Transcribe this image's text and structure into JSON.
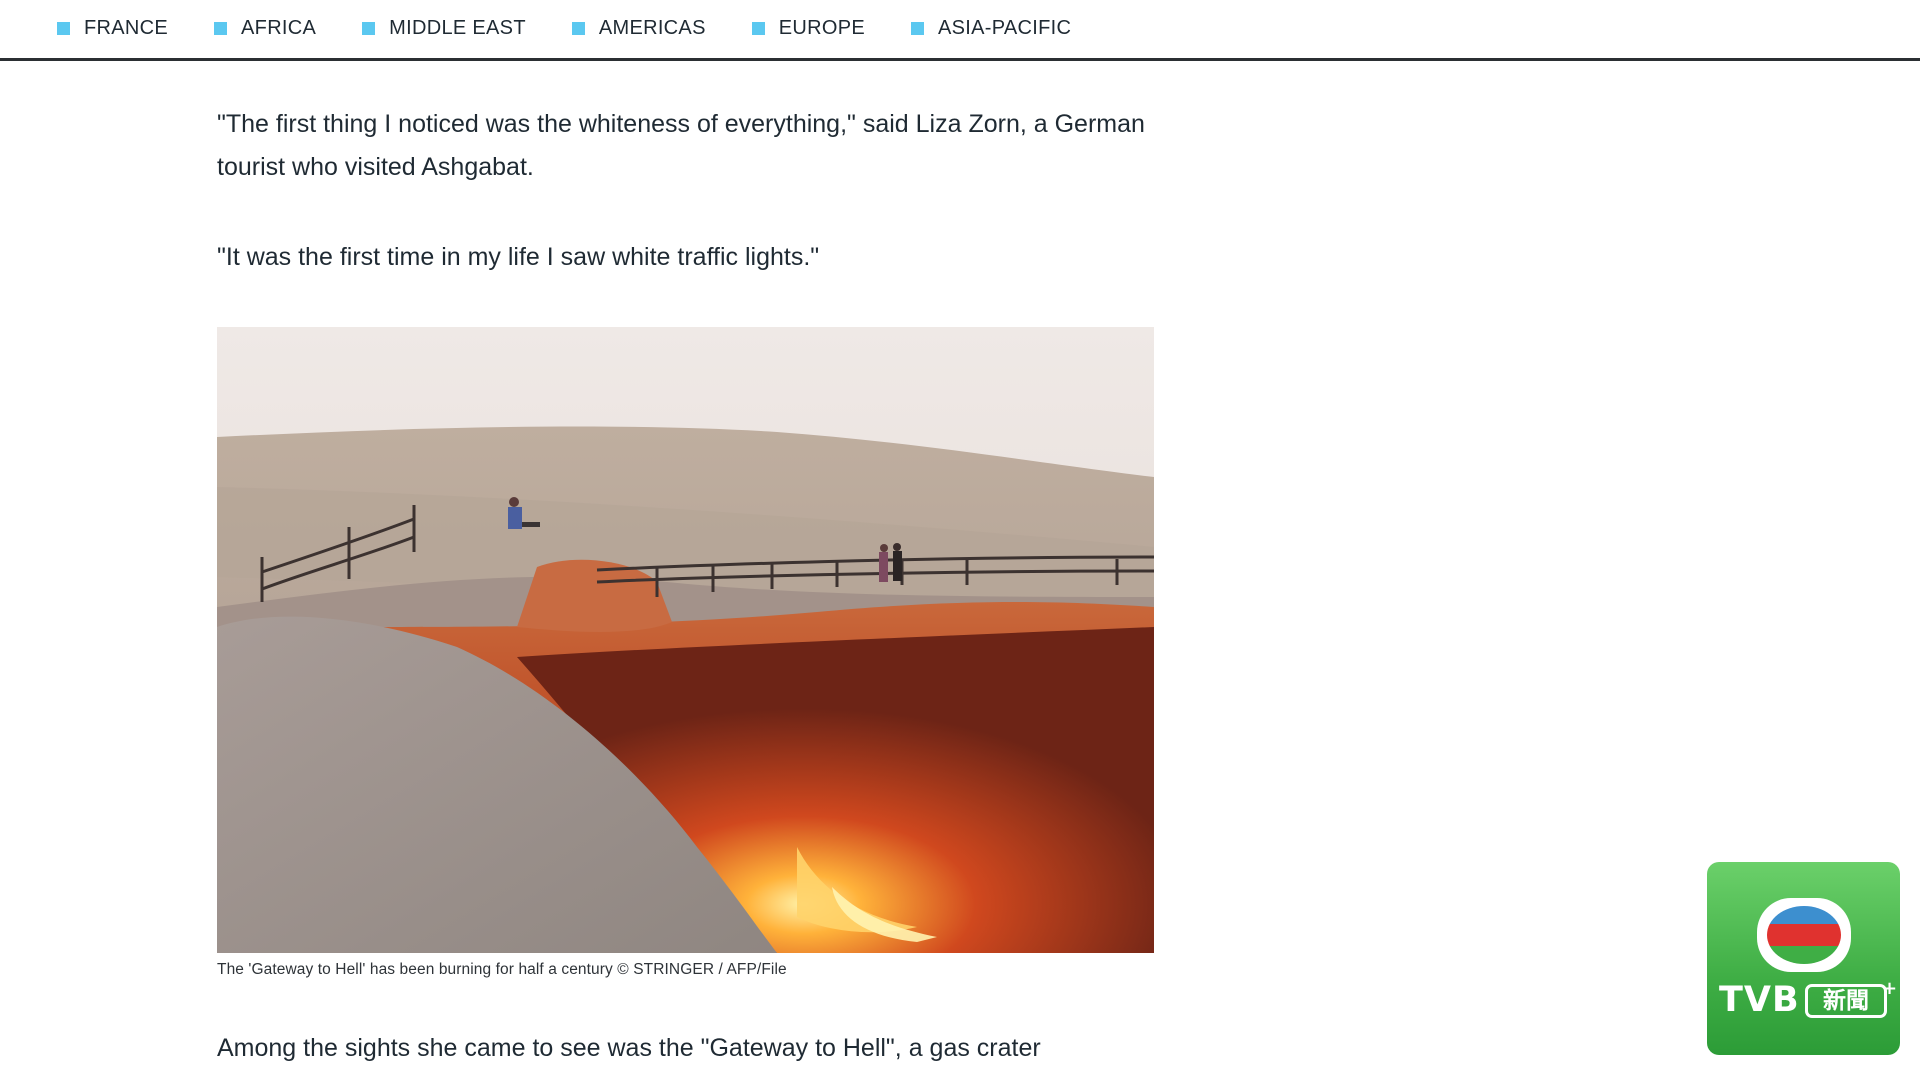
{
  "nav": {
    "items": [
      {
        "label": "FRANCE"
      },
      {
        "label": "AFRICA"
      },
      {
        "label": "MIDDLE EAST"
      },
      {
        "label": "AMERICAS"
      },
      {
        "label": "EUROPE"
      },
      {
        "label": "ASIA-PACIFIC"
      }
    ],
    "accent_color": "#5bc8f0"
  },
  "article": {
    "paragraph1": "\"The first thing I noticed was the whiteness of everything,\" said Liza Zorn, a German tourist who visited Ashgabat.",
    "paragraph2": "\"It was the first time in my life I saw white traffic lights.\"",
    "photo_caption": "The 'Gateway to Hell' has been burning for half a century © STRINGER / AFP/File",
    "paragraph3": "Among the sights she came to see was the \"Gateway to Hell\", a gas crater"
  },
  "watermark": {
    "brand": "TVB",
    "news_label": "新聞",
    "plus": "+",
    "background_color": "#3fae45"
  }
}
